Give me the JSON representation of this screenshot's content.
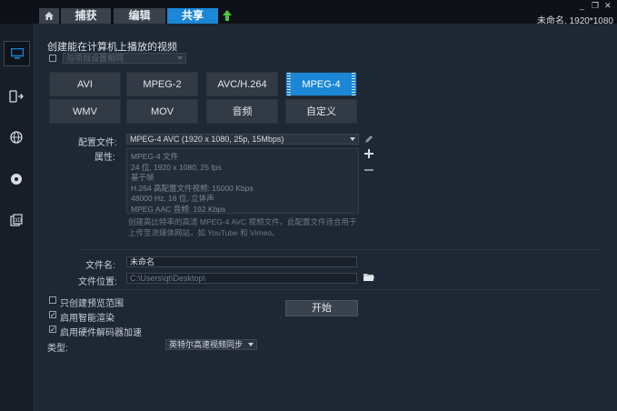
{
  "tabs": {
    "capture": "捕获",
    "edit": "编辑",
    "share": "共享"
  },
  "window": {
    "title": "未命名, 1920*1080",
    "minimize": "_",
    "restore": "❐",
    "close": "✕"
  },
  "sidebar": {
    "items": [
      {
        "name": "computer-output-icon",
        "active": true
      },
      {
        "name": "device-output-icon",
        "active": false
      },
      {
        "name": "web-output-icon",
        "active": false
      },
      {
        "name": "disc-output-icon",
        "active": false
      },
      {
        "name": "3d-output-icon",
        "active": false
      }
    ]
  },
  "section_title": "创建能在计算机上播放的视频",
  "match_project": {
    "label": "与项目设置相同",
    "checked": false
  },
  "formats": [
    {
      "label": "AVI",
      "selected": false
    },
    {
      "label": "MPEG-2",
      "selected": false
    },
    {
      "label": "AVC/H.264",
      "selected": false
    },
    {
      "label": "MPEG-4",
      "selected": true
    },
    {
      "label": "WMV",
      "selected": false
    },
    {
      "label": "MOV",
      "selected": false
    },
    {
      "label": "音频",
      "selected": false
    },
    {
      "label": "自定义",
      "selected": false
    }
  ],
  "profile": {
    "label": "配置文件:",
    "value": "MPEG-4 AVC (1920 x 1080, 25p, 15Mbps)"
  },
  "properties": {
    "label": "属性:",
    "lines": [
      "MPEG-4 文件",
      "24 位, 1920 x 1080, 25 fps",
      "基于帧",
      "H.264 高配置文件视频: 15000 Kbps",
      "48000 Hz, 16 位, 立体声",
      "MPEG AAC 音频: 192 Kbps"
    ]
  },
  "description": "创建高比特率的高清 MPEG-4 AVC 视频文件。此配置文件适合用于上传至流媒体网站，如 YouTube 和 Vimeo。",
  "filename": {
    "label": "文件名:",
    "value": "未命名"
  },
  "location": {
    "label": "文件位置:",
    "value": "C:\\Users\\qt\\Desktop\\"
  },
  "options": {
    "preview_only": {
      "label": "只创建预览范围",
      "checked": false
    },
    "smart_render": {
      "label": "启用智能渲染",
      "checked": true
    },
    "hw_accel": {
      "label": "启用硬件解码器加速",
      "checked": true
    }
  },
  "type": {
    "label": "类型:",
    "value": "英特尔高速视频同步"
  },
  "start_button": "开始",
  "colors": {
    "accent": "#1b87d6",
    "upload_arrow": "#4cc63a"
  }
}
